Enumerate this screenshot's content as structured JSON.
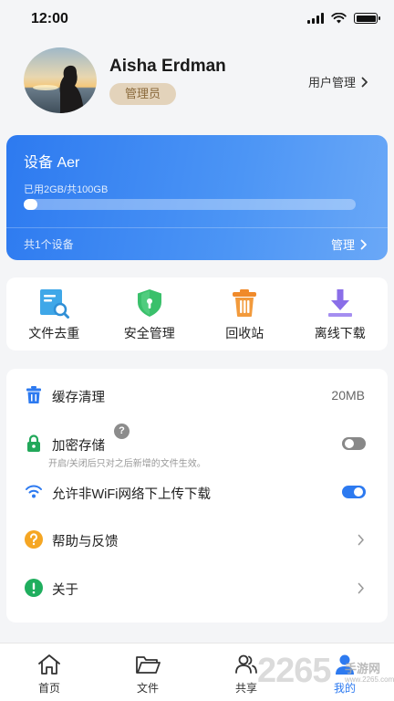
{
  "status_bar": {
    "time": "12:00"
  },
  "profile": {
    "name": "Aisha Erdman",
    "role": "管理员",
    "user_manage_label": "用户管理"
  },
  "device": {
    "title": "设备 Aer",
    "usage_text": "已用2GB/共100GB",
    "usage_fraction": 0.02,
    "count_text": "共1个设备",
    "manage_label": "管理"
  },
  "tools": [
    {
      "label": "文件去重",
      "icon": "file-search-icon"
    },
    {
      "label": "安全管理",
      "icon": "shield-icon"
    },
    {
      "label": "回收站",
      "icon": "trash-icon"
    },
    {
      "label": "离线下载",
      "icon": "download-icon"
    }
  ],
  "settings": {
    "cache": {
      "label": "缓存清理",
      "value": "20MB"
    },
    "encrypt": {
      "label": "加密存储",
      "help": "?",
      "sub": "开启/关闭后只对之后新增的文件生效。",
      "enabled": false
    },
    "wifi": {
      "label": "允许非WiFi网络下上传下载",
      "enabled": true
    },
    "help": {
      "label": "帮助与反馈"
    },
    "about": {
      "label": "关于"
    }
  },
  "nav": [
    {
      "label": "首页",
      "icon": "home-icon",
      "active": false
    },
    {
      "label": "文件",
      "icon": "folder-icon",
      "active": false
    },
    {
      "label": "共享",
      "icon": "share-users-icon",
      "active": false
    },
    {
      "label": "我的",
      "icon": "user-icon",
      "active": true
    }
  ],
  "watermark": {
    "number": "2265",
    "text": "手游网",
    "url": "www.2265.com"
  },
  "colors": {
    "accent": "#2d7af0",
    "badge_bg": "#e3d3bb",
    "badge_text": "#8a6a3c"
  }
}
